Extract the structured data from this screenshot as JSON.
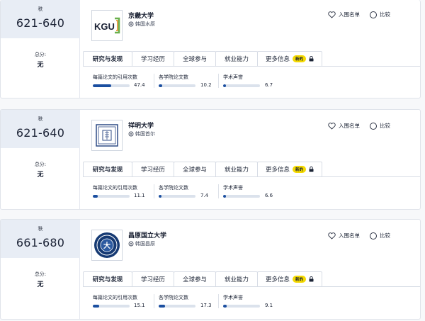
{
  "cards": [
    {
      "rank_label": "秩",
      "rank": "621-640",
      "score_label": "总分:",
      "score": "无",
      "name": "京畿大学",
      "location": "韩国水原",
      "logo": "kgu-logo",
      "logo_text": "KGU",
      "metrics": [
        {
          "label": "每篇论文的引用次数",
          "value": "47.4",
          "fill": 0.5
        },
        {
          "label": "各学院论文数",
          "value": "10.2",
          "fill": 0.1
        },
        {
          "label": "学术声誉",
          "value": "6.7",
          "fill": 0.08
        }
      ]
    },
    {
      "rank_label": "秩",
      "rank": "621-640",
      "score_label": "总分:",
      "score": "无",
      "name": "祥明大学",
      "location": "韩国首尔",
      "logo": "sangmyung-seal",
      "logo_text": "",
      "metrics": [
        {
          "label": "每篇论文的引用次数",
          "value": "11.1",
          "fill": 0.13
        },
        {
          "label": "各学院论文数",
          "value": "7.4",
          "fill": 0.07
        },
        {
          "label": "学术声誉",
          "value": "6.6",
          "fill": 0.08
        }
      ]
    },
    {
      "rank_label": "秩",
      "rank": "661-680",
      "score_label": "总分:",
      "score": "无",
      "name": "昌原国立大学",
      "location": "韩国昌原",
      "logo": "changwon-emblem",
      "logo_text": "大",
      "metrics": [
        {
          "label": "每篇论文的引用次数",
          "value": "15.1",
          "fill": 0.17
        },
        {
          "label": "各学院论文数",
          "value": "17.3",
          "fill": 0.18
        },
        {
          "label": "学术声誉",
          "value": "9.1",
          "fill": 0.1
        }
      ]
    }
  ],
  "tabs": [
    "研究与发现",
    "学习经历",
    "全球参与",
    "就业能力",
    "更多信息"
  ],
  "new_badge": "新的",
  "shortlist_label": "入围名单",
  "compare_label": "比较",
  "icons": {
    "shortlist": "heart-icon",
    "compare": "radio-icon",
    "location": "location-pin-icon",
    "locked": "lock-icon"
  },
  "colors": {
    "accent": "#1b4fa0",
    "rank_bg": "#e8edf5",
    "badge": "#f4d900",
    "kgu_green": "#6ab04c",
    "kgu_orange": "#e08a1e",
    "emblem_blue": "#163a73"
  }
}
